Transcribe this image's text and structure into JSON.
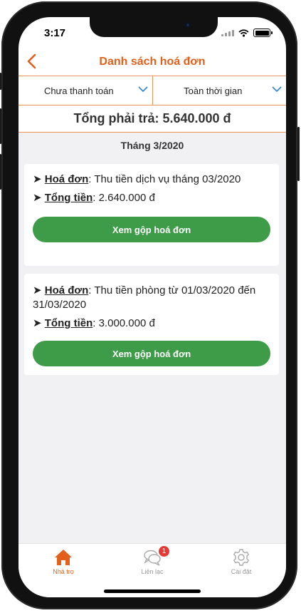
{
  "status_bar": {
    "time": "3:17"
  },
  "header": {
    "title": "Danh sách hoá đơn"
  },
  "filters": [
    {
      "label": "Chưa thanh toán"
    },
    {
      "label": "Toàn thời gian"
    }
  ],
  "total": {
    "text": "Tổng phải trả: 5.640.000 đ"
  },
  "month": {
    "label": "Tháng 3/2020"
  },
  "invoices": [
    {
      "invoice_key": "Hoá đơn",
      "invoice_value": "Thu tiền dịch vụ tháng 03/2020",
      "total_key": "Tổng tiền",
      "total_value": "2.640.000 đ",
      "button": "Xem gộp hoá đơn"
    },
    {
      "invoice_key": "Hoá đơn",
      "invoice_value": "Thu tiền phòng từ 01/03/2020 đến 31/03/2020",
      "total_key": "Tổng tiền",
      "total_value": "3.000.000 đ",
      "button": "Xem gộp hoá đơn"
    }
  ],
  "tabs": [
    {
      "label": "Nhà trọ",
      "icon": "home-icon",
      "active": true
    },
    {
      "label": "Liên lạc",
      "icon": "chat-icon",
      "badge": "1"
    },
    {
      "label": "Cài đặt",
      "icon": "gear-icon"
    }
  ],
  "colors": {
    "accent": "#e2601b",
    "button": "#3e9c48",
    "badge": "#e53935"
  }
}
